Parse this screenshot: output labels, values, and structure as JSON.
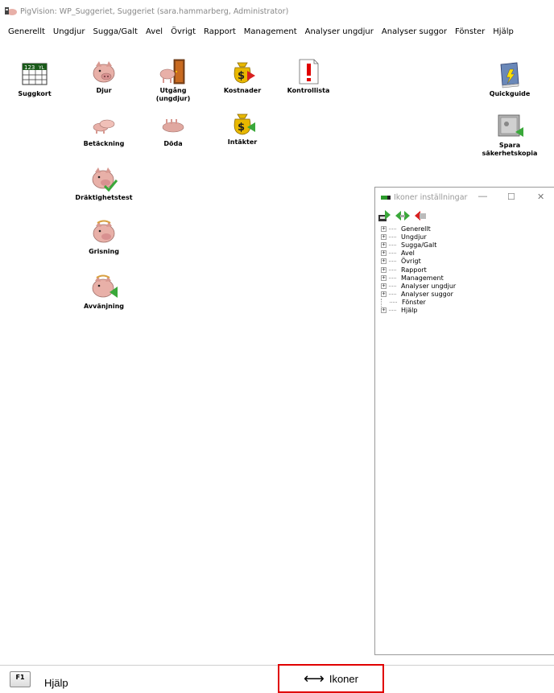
{
  "window": {
    "title": "PigVision: WP_Suggeriet, Suggeriet (sara.hammarberg, Administrator)"
  },
  "menu": [
    "Generellt",
    "Ungdjur",
    "Sugga/Galt",
    "Avel",
    "Övrigt",
    "Rapport",
    "Management",
    "Analyser ungdjur",
    "Analyser suggor",
    "Fönster",
    "Hjälp"
  ],
  "icons": {
    "suggkort": {
      "label": "Suggkort",
      "card_text": "123",
      "card_code": "YL"
    },
    "djur": {
      "label": "Djur"
    },
    "utgang": {
      "label": "Utgång\n(ungdjur)"
    },
    "kostnader": {
      "label": "Kostnader"
    },
    "kontrollista": {
      "label": "Kontrollista"
    },
    "quickguide": {
      "label": "Quickguide"
    },
    "betackning": {
      "label": "Betäckning"
    },
    "doda": {
      "label": "Döda"
    },
    "intakter": {
      "label": "Intäkter"
    },
    "spara": {
      "label": "Spara\nsäkerhetskopia"
    },
    "draktighetstest": {
      "label": "Dräktighetstest"
    },
    "grisning": {
      "label": "Grisning"
    },
    "avvanjning": {
      "label": "Avvänjning"
    }
  },
  "ikoner_window": {
    "title": "Ikoner inställningar",
    "tree": [
      {
        "label": "Generellt",
        "expandable": true
      },
      {
        "label": "Ungdjur",
        "expandable": true
      },
      {
        "label": "Sugga/Galt",
        "expandable": true
      },
      {
        "label": "Avel",
        "expandable": true
      },
      {
        "label": "Övrigt",
        "expandable": true
      },
      {
        "label": "Rapport",
        "expandable": true
      },
      {
        "label": "Management",
        "expandable": true
      },
      {
        "label": "Analyser ungdjur",
        "expandable": true
      },
      {
        "label": "Analyser suggor",
        "expandable": true
      },
      {
        "label": "Fönster",
        "expandable": false
      },
      {
        "label": "Hjälp",
        "expandable": true
      }
    ]
  },
  "statusbar": {
    "f1_key": "F1",
    "help_label": "Hjälp",
    "ikoner_label": "Ikoner",
    "ikoner_arrow": "⟷"
  },
  "colors": {
    "highlight": "#e00000",
    "pig": "#e8b0a8",
    "green": "#3aa83a",
    "red": "#d82020",
    "gold": "#e8b800"
  }
}
